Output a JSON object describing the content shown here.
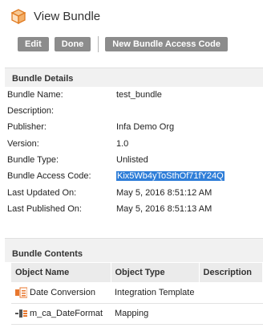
{
  "header": {
    "title": "View Bundle",
    "icon": "box-icon"
  },
  "toolbar": {
    "edit": "Edit",
    "done": "Done",
    "new_code": "New Bundle Access Code"
  },
  "details": {
    "heading": "Bundle Details",
    "rows": [
      {
        "label": "Bundle Name:",
        "value": "test_bundle"
      },
      {
        "label": "Description:",
        "value": ""
      },
      {
        "label": "Publisher:",
        "value": "Infa Demo Org"
      },
      {
        "label": "Version:",
        "value": "1.0"
      },
      {
        "label": "Bundle Type:",
        "value": "Unlisted"
      },
      {
        "label": "Bundle Access Code:",
        "value": "Kix5Wb4yToSthOf71fY24Q"
      },
      {
        "label": "Last Updated On:",
        "value": "May 5, 2016 8:51:12 AM"
      },
      {
        "label": "Last Published On:",
        "value": "May 5, 2016 8:51:13 AM"
      }
    ]
  },
  "contents": {
    "heading": "Bundle Contents",
    "columns": [
      "Object Name",
      "Object Type",
      "Description"
    ],
    "rows": [
      {
        "name": "Date Conversion",
        "type": "Integration Template",
        "description": "",
        "icon": "integration-template-icon"
      },
      {
        "name": "m_ca_DateFormat",
        "type": "Mapping",
        "description": "",
        "icon": "mapping-icon"
      }
    ]
  },
  "colors": {
    "button": "#8c8c8c",
    "highlight": "#2f7ed8",
    "accent": "#e8772e"
  }
}
